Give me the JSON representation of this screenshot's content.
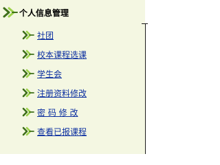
{
  "section": {
    "title": "个人信息管理",
    "icon": "double-chevron-icon"
  },
  "menu": {
    "items": [
      {
        "label": "社团"
      },
      {
        "label": "校本课程选课"
      },
      {
        "label": "学生会"
      },
      {
        "label": "注册资料修改"
      },
      {
        "label": "密 码 修 改"
      },
      {
        "label": "查看已报课程"
      }
    ],
    "item_icon": "double-chevron-icon"
  },
  "colors": {
    "panel_background": "#f4f7e2",
    "link": "#0a2ea0",
    "icon_dark": "#3e6f1a",
    "icon_light": "#9dd24a"
  }
}
